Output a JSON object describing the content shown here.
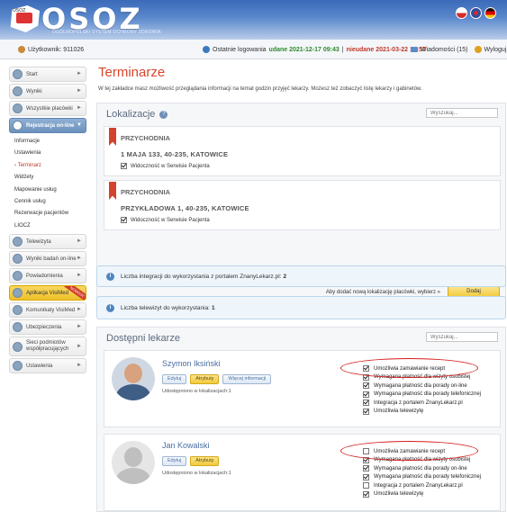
{
  "header": {
    "logo_text": "OSOZ",
    "logo_sub": "OGÓLNOPOLSKI SYSTEM OCHRONY ZDROWIA",
    "logo_map_text": "OSOZ",
    "flags": [
      "flag-red-white",
      "flag-uk",
      "flag-de"
    ],
    "colors": {
      "bar_top": "#3a6ab8",
      "bar_bottom": "#b9cde9"
    }
  },
  "topbar": {
    "user_label": "Użytkownik: 911026",
    "last_login_label": "Ostatnie logowania",
    "ok_label": "udane 2021-12-17 09:43",
    "separator": "|",
    "bad_label": "nieudane 2021-03-22 13:57",
    "messages_label": "Wiadomości (15)",
    "logout_label": "Wyloguj"
  },
  "sidebar": {
    "items": [
      {
        "label": "Start",
        "icon": "home-icon"
      },
      {
        "label": "Wyniki",
        "icon": "results-icon"
      },
      {
        "label": "Wszystkie placówki",
        "icon": "clinic-icon"
      },
      {
        "label": "Rejestracja on-line",
        "icon": "calendar-icon"
      }
    ],
    "subitems": [
      "Informacje",
      "Ustawienia",
      "Terminarz",
      "Widżety",
      "Mapowanie usług",
      "Cennik usług",
      "Rezerwacje pacjentów",
      "LIOCZ"
    ],
    "items2": [
      {
        "label": "Telewizyta",
        "icon": "video-icon"
      },
      {
        "label": "Wyniki badań on-line",
        "icon": "lab-icon"
      },
      {
        "label": "Powiadomienia",
        "icon": "bell-icon"
      },
      {
        "label": "Aplikacja VisiMed",
        "icon": "app-icon",
        "badge": "NOWOŚĆ"
      },
      {
        "label": "Komunikaty VisiMed",
        "icon": "message-icon"
      },
      {
        "label": "Ubezpieczenia",
        "icon": "insurance-icon"
      },
      {
        "label": "Sieci podmiotów współpracujących",
        "icon": "network-icon"
      },
      {
        "label": "Ustawienia",
        "icon": "settings-icon"
      }
    ]
  },
  "main": {
    "title": "Terminarze",
    "description": "W tej zakładce masz możliwość przeglądania informacji na temat godzin przyjęć lekarzy. Możesz też zobaczyć listę lekarzy i gabinetów.",
    "locations": {
      "header": "Lokalizacje",
      "search_placeholder": "Wyszukaj...",
      "items": [
        {
          "name": "PRZYCHODNIA",
          "address": "1 MAJA 133, 40-235, KATOWICE",
          "visible_label": "Widoczność w Serwisie Pacjenta",
          "checked": true
        },
        {
          "name": "PRZYCHODNIA",
          "address": "PRZYKŁADOWA 1, 40-235, KATOWICE",
          "visible_label": "Widoczność w Serwisie Pacjenta",
          "checked": true
        }
      ],
      "add_text": "Aby dodać nową lokalizację placówki, wybierz »",
      "add_button": "Dodaj"
    },
    "info1": {
      "text": "Liczba integracji do wykorzystania z portalem ZnanyLekarz.pl:",
      "value": "2"
    },
    "info2": {
      "text": "Liczba telewizyt do wykorzystania:",
      "value": "1"
    },
    "doctors": {
      "header": "Dostępni lekarze",
      "search_placeholder": "Wyszukaj...",
      "items": [
        {
          "name": "Szymon Iksiński",
          "edit": "Edytuj",
          "attributes": "Atrybuty",
          "more": "Więcej informacji",
          "shared": "Udostępniono w lokalizacjach:1",
          "options": [
            {
              "label": "Umożliwia zamawianie recept",
              "checked": true
            },
            {
              "label": "Wymagana płatność dla wizyty osobistej",
              "checked": true
            },
            {
              "label": "Wymagana płatność dla porady on-line",
              "checked": true
            },
            {
              "label": "Wymagana płatność dla porady telefonicznej",
              "checked": true
            },
            {
              "label": "Integracja z portalem ZnanyLekarz.pl",
              "checked": true
            },
            {
              "label": "Umożliwia telewizytę",
              "checked": true
            }
          ]
        },
        {
          "name": "Jan Kowalski",
          "edit": "Edytuj",
          "attributes": "Atrybuty",
          "shared": "Udostępniono w lokalizacjach:1",
          "options": [
            {
              "label": "Umożliwia zamawianie recept",
              "checked": false
            },
            {
              "label": "Wymagana płatność dla wizyty osobistej",
              "checked": true
            },
            {
              "label": "Wymagana płatność dla porady on-line",
              "checked": true
            },
            {
              "label": "Wymagana płatność dla porady telefonicznej",
              "checked": true
            },
            {
              "label": "Integracja z portalem ZnanyLekarz.pl",
              "checked": false
            },
            {
              "label": "Umożliwia telewizytę",
              "checked": true
            }
          ]
        }
      ]
    }
  }
}
